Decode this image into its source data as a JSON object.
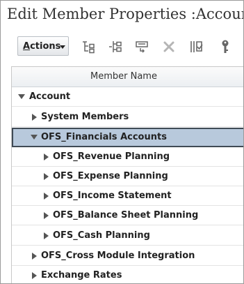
{
  "page": {
    "title": "Edit Member Properties :Account"
  },
  "toolbar": {
    "actions_label_first": "A",
    "actions_label_rest": "ctions",
    "icons": [
      "add-child-icon",
      "add-sibling-icon",
      "move-icon",
      "delete-icon",
      "validate-icon",
      "key-icon"
    ]
  },
  "grid": {
    "column_header": "Member Name",
    "rows": [
      {
        "label": "Account",
        "expanded": true,
        "level": 0
      },
      {
        "label": "System Members",
        "expanded": false,
        "level": 1
      },
      {
        "label": "OFS_Financials Accounts",
        "expanded": true,
        "level": 1,
        "selected": true
      },
      {
        "label": "OFS_Revenue Planning",
        "expanded": false,
        "level": 2
      },
      {
        "label": "OFS_Expense Planning",
        "expanded": false,
        "level": 2
      },
      {
        "label": "OFS_Income Statement",
        "expanded": false,
        "level": 2
      },
      {
        "label": "OFS_Balance Sheet Planning",
        "expanded": false,
        "level": 2
      },
      {
        "label": "OFS_Cash Planning",
        "expanded": false,
        "level": 2
      },
      {
        "label": "OFS_Cross Module Integration",
        "expanded": false,
        "level": 1
      },
      {
        "label": "Exchange Rates",
        "expanded": false,
        "level": 1
      }
    ]
  },
  "colors": {
    "selected_row": "#b8c9dc",
    "selected_border": "#3f4a55"
  }
}
